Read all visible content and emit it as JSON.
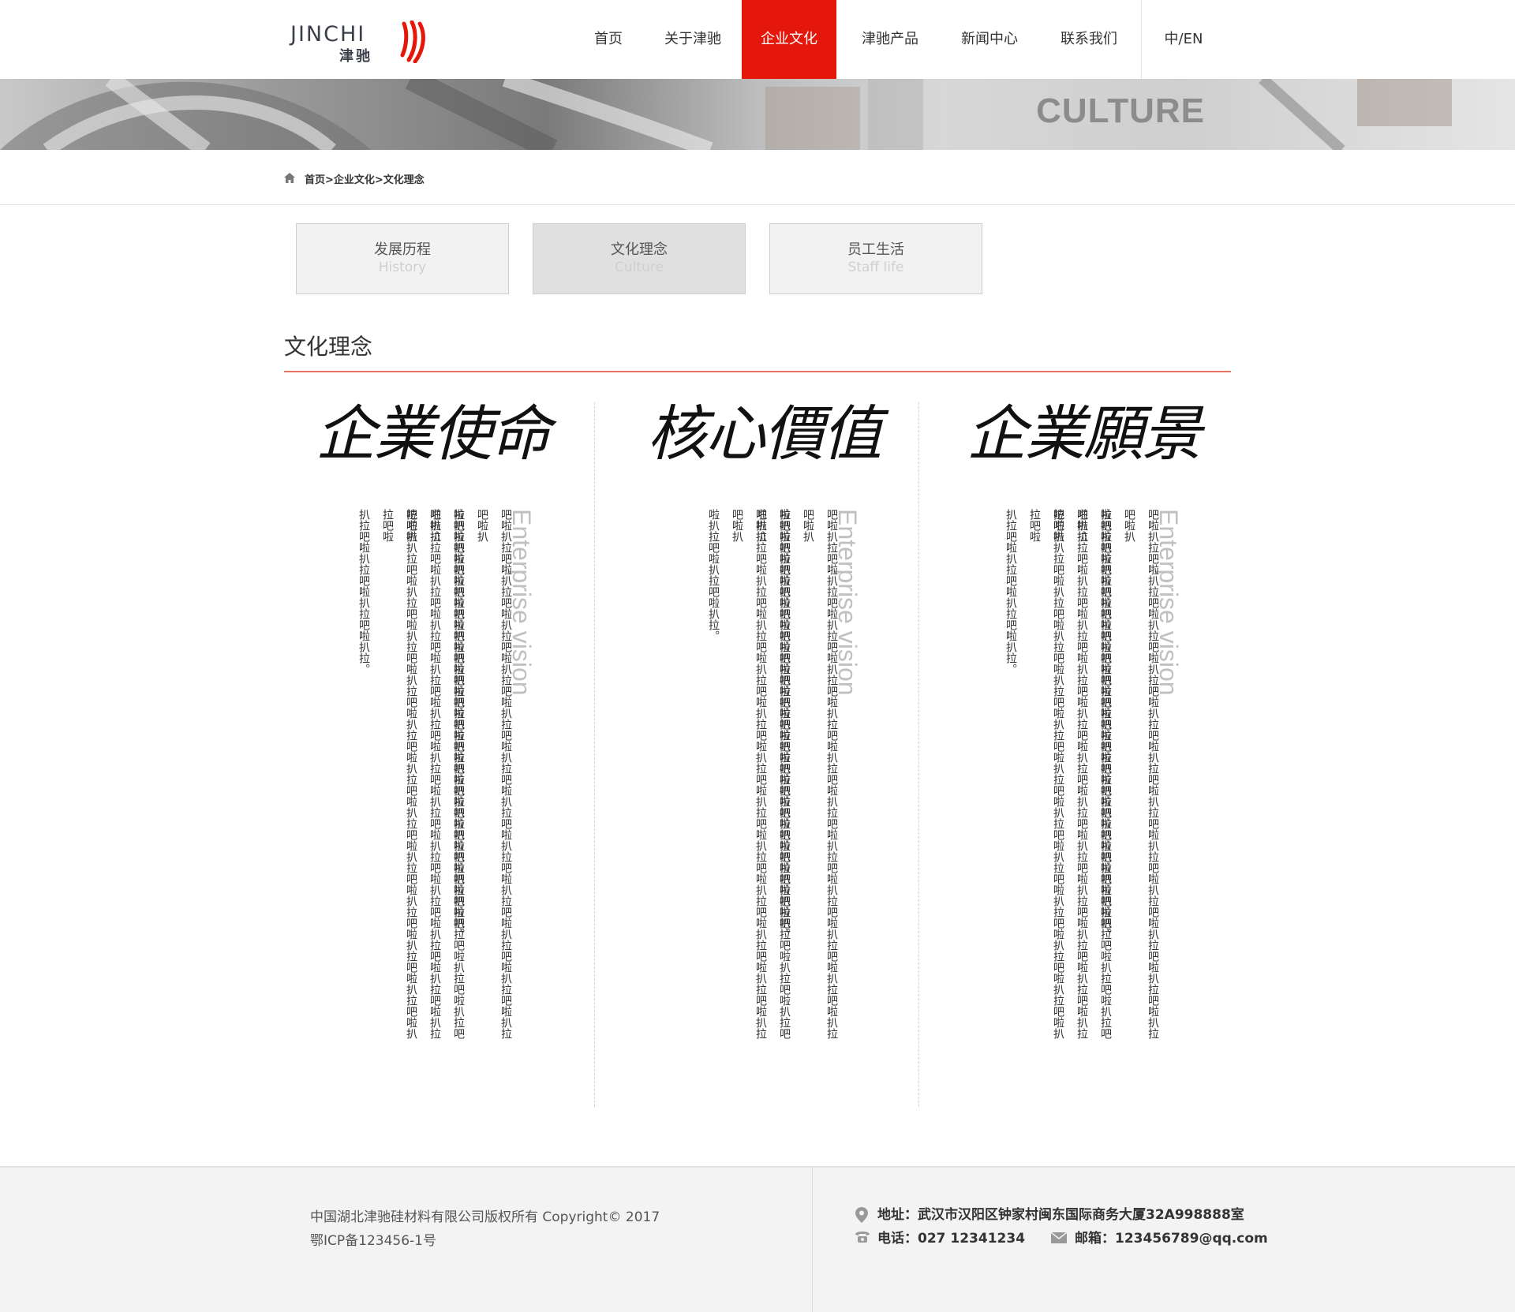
{
  "brand": {
    "logo_en": "JINCHI",
    "logo_cn": "津驰"
  },
  "nav": {
    "items": [
      {
        "label": "首页"
      },
      {
        "label": "关于津驰"
      },
      {
        "label": "企业文化"
      },
      {
        "label": "津驰产品"
      },
      {
        "label": "新闻中心"
      },
      {
        "label": "联系我们"
      }
    ],
    "active_index": 2,
    "lang": "中/EN"
  },
  "banner": {
    "word": "CULTURE"
  },
  "breadcrumb": {
    "text": "首页>企业文化>文化理念"
  },
  "tabs": [
    {
      "cn": "发展历程",
      "en": "History"
    },
    {
      "cn": "文化理念",
      "en": "Culture"
    },
    {
      "cn": "员工生活",
      "en": "Staff life"
    }
  ],
  "section": {
    "title": "文化理念"
  },
  "columns": [
    {
      "heading": "企業使命",
      "en_title": "Enterprise vision",
      "lines": [
        "吧啦扒拉吧啦扒拉吧啦扒拉吧啦扒拉吧啦扒拉吧啦扒拉吧啦扒拉吧啦扒拉吧啦扒拉吧啦扒拉吧啦扒拉吧啦扒拉吧啦扒",
        "拉吧啦扒拉吧啦扒拉吧啦扒拉吧啦扒拉吧啦扒拉吧啦扒拉吧啦扒拉吧啦扒拉吧啦扒拉吧。",
        "啦扒拉吧啦扒拉吧啦扒拉吧啦扒拉吧啦扒拉吧啦扒拉吧啦扒拉吧啦扒拉吧啦扒拉吧啦扒拉吧啦扒拉吧啦扒拉吧啦扒拉",
        "吧啦扒拉吧啦扒拉吧啦扒拉吧啦扒拉吧啦扒拉吧啦扒拉吧啦扒拉吧啦扒拉吧啦扒拉吧啦扒拉吧啦扒拉吧啦扒拉吧啦扒",
        "拉吧啦扒拉吧啦扒拉吧啦扒拉吧啦扒拉吧啦扒拉吧啦扒拉吧啦扒拉吧啦扒拉吧啦扒拉吧啦扒拉吧啦扒拉吧啦扒拉吧啦",
        "扒拉吧啦扒拉吧啦扒拉吧啦扒拉。"
      ]
    },
    {
      "heading": "核心價值",
      "en_title": "Enterprise vision",
      "lines": [
        "吧啦扒拉吧啦扒拉吧啦扒拉吧啦扒拉吧啦扒拉吧啦扒拉吧啦扒拉吧啦扒拉吧啦扒拉吧啦扒拉吧啦扒拉吧啦扒拉吧啦扒",
        "拉吧啦扒拉吧啦扒拉吧啦扒拉吧啦扒拉吧啦扒拉吧啦扒拉吧啦扒拉吧啦扒拉吧啦扒拉吧。",
        "啦扒拉吧啦扒拉吧啦扒拉吧啦扒拉吧啦扒拉吧啦扒拉吧啦扒拉吧啦扒拉吧啦扒拉吧啦扒拉吧啦扒拉吧啦扒拉吧啦扒拉",
        "吧啦扒拉吧啦扒拉吧啦扒拉吧啦扒拉吧啦扒拉吧啦扒拉吧啦扒拉吧啦扒拉吧啦扒拉吧啦扒拉吧啦扒拉吧啦扒拉吧啦扒",
        "啦扒拉吧啦扒拉吧啦扒拉。"
      ]
    },
    {
      "heading": "企業願景",
      "en_title": "Enterprise vision",
      "lines": [
        "吧啦扒拉吧啦扒拉吧啦扒拉吧啦扒拉吧啦扒拉吧啦扒拉吧啦扒拉吧啦扒拉吧啦扒拉吧啦扒拉吧啦扒拉吧啦扒拉吧啦扒",
        "拉吧啦扒拉吧啦扒拉吧啦扒拉吧啦扒拉吧啦扒拉吧啦扒拉吧啦扒拉吧啦扒拉吧啦扒拉吧。",
        "啦扒拉吧啦扒拉吧啦扒拉吧啦扒拉吧啦扒拉吧啦扒拉吧啦扒拉吧啦扒拉吧啦扒拉吧啦扒拉吧啦扒拉吧啦扒拉吧啦扒拉",
        "吧啦扒拉吧啦扒拉吧啦扒拉吧啦扒拉吧啦扒拉吧啦扒拉吧啦扒拉吧啦扒拉吧啦扒拉吧啦扒拉吧啦扒拉吧啦扒拉吧啦扒",
        "拉吧啦扒拉吧啦扒拉吧啦扒拉吧啦扒拉吧啦扒拉吧啦扒拉吧啦扒拉吧啦扒拉吧啦扒拉吧啦扒拉吧啦扒拉吧啦扒拉吧啦",
        "扒拉吧啦扒拉吧啦扒拉吧啦扒拉。"
      ]
    }
  ],
  "footer": {
    "copyright": "中国湖北津驰硅材料有限公司版权所有 Copyright© 2017",
    "icp": "鄂ICP备123456-1号",
    "address": "地址：武汉市汉阳区钟家村闽东国际商务大厦32A998888室",
    "phone": "电话：027 12341234",
    "email": "邮箱：123456789@qq.com"
  },
  "colors": {
    "accent": "#e5160a",
    "rule": "#e8715f",
    "muted": "#c0c0c0"
  },
  "icons": [
    "home-icon",
    "location-icon",
    "phone-icon",
    "mail-icon"
  ]
}
